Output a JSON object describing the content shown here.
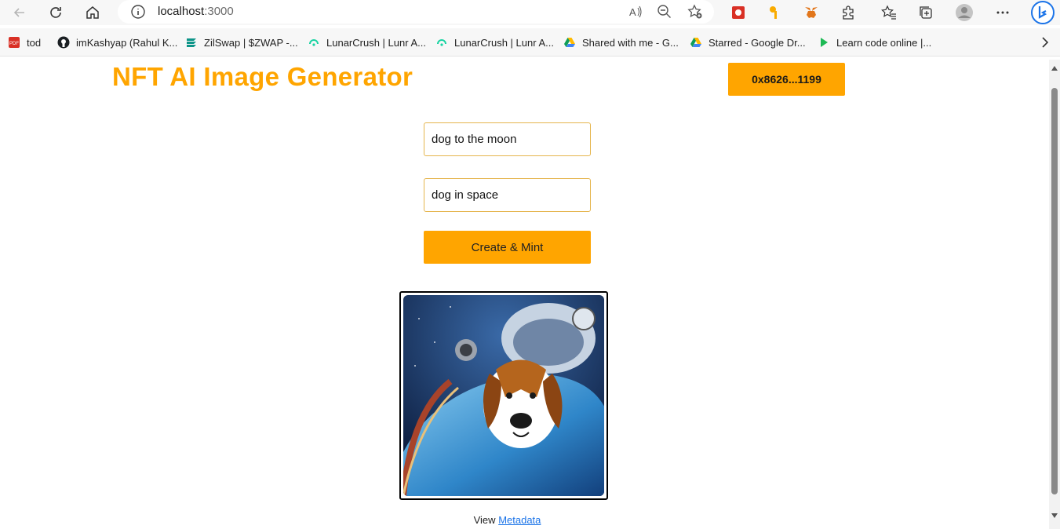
{
  "browser": {
    "url_host": "localhost",
    "url_port": ":3000",
    "bookmarks": [
      {
        "label": "tod",
        "icon": "pdf-icon"
      },
      {
        "label": "imKashyap (Rahul K...",
        "icon": "github-icon"
      },
      {
        "label": "ZilSwap | $ZWAP -...",
        "icon": "zilswap-icon"
      },
      {
        "label": "LunarCrush | Lunr A...",
        "icon": "lunarcrush-icon"
      },
      {
        "label": "LunarCrush | Lunr A...",
        "icon": "lunarcrush-icon"
      },
      {
        "label": "Shared with me - G...",
        "icon": "google-drive-icon"
      },
      {
        "label": "Starred - Google Dr...",
        "icon": "google-drive-icon"
      },
      {
        "label": "Learn code online |...",
        "icon": "play-icon"
      }
    ]
  },
  "app": {
    "title": "NFT AI Image Generator",
    "wallet_label": "0x8626...1199",
    "prompt_value": "dog to the moon",
    "name_value": "dog in space",
    "mint_label": "Create & Mint",
    "view_label": "View",
    "metadata_link": "Metadata",
    "image_alt": "generated-nft-dog-astronaut"
  },
  "colors": {
    "accent": "#ffa500",
    "link": "#1a73e8"
  }
}
